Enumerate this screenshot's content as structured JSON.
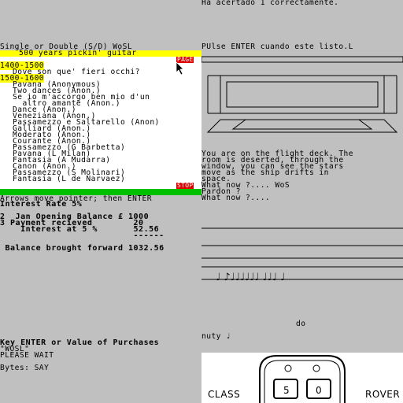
{
  "top_right": {
    "message": "Ha acertado 1 correctamente.",
    "prompt": "PUlse ENTER cuando este listo.L"
  },
  "menu": {
    "title": "Single or Double (S/D) WoSL",
    "header": "500 years pickin' guitar",
    "page_button": "PAGE",
    "section1": "1400-1500",
    "item_dove": "Dove son que' fieri occhi?",
    "section2": "1500-1600",
    "items": [
      "Pavana (Anonymous)",
      "Two dances (Anon.)",
      "Se io m'accorgo ben mio d'un",
      "  altro amante (Anon.)",
      "Dance (Anon.)",
      "Veneziana (Anon.)",
      "Passamezzo e Saltarello (Anon)",
      "Galliard (Anon.)",
      "Moderato (Anon.)",
      "Courante (Anon.)",
      "Passamezzo (G Barbetta)",
      "Pavana (L Milan)",
      "Fantasia (A Mudarra)",
      "Canon (Anon.)",
      "Passamezzo (S Molinari)",
      "Fantasia (L de Narvaez)"
    ],
    "stop_button": "STOP",
    "status_bar": "Arrows move pointer; then ENTER"
  },
  "finance": {
    "interest_rate": "Interest Rate 5%",
    "row1": "2  Jan Opening Balance £ 1000",
    "row2": "3 Payment recieved        20",
    "row3": "    Interest at 5 %       52.56",
    "rule": "                          ------",
    "balance": " Balance brought forward 1032.56"
  },
  "adventure": {
    "lines": [
      "You are on the flight deck. The",
      "room is deserted, through the",
      "window, you can see the stars",
      "move as the ship drifts in",
      "space.",
      "What now ?.... WoS",
      "Pardon ?",
      "What now ?...."
    ]
  },
  "music": {
    "do_label": "do",
    "nuty_label": "nuty ♩"
  },
  "bottom_left": {
    "purchases": "Key ENTER or Value of Purchases",
    "wosl": "\"WOSL\"",
    "please_wait": "PLEASE WAIT",
    "bytes": "Bytes: SAY"
  },
  "console": {
    "left_label": "CLASS",
    "right_label": "ROVER",
    "digit1": "5",
    "digit2": "0"
  },
  "colors": {
    "background": "#c0c0c0",
    "highlight_yellow": "#ffff00",
    "button_red": "#e00000",
    "status_green": "#00c000"
  }
}
